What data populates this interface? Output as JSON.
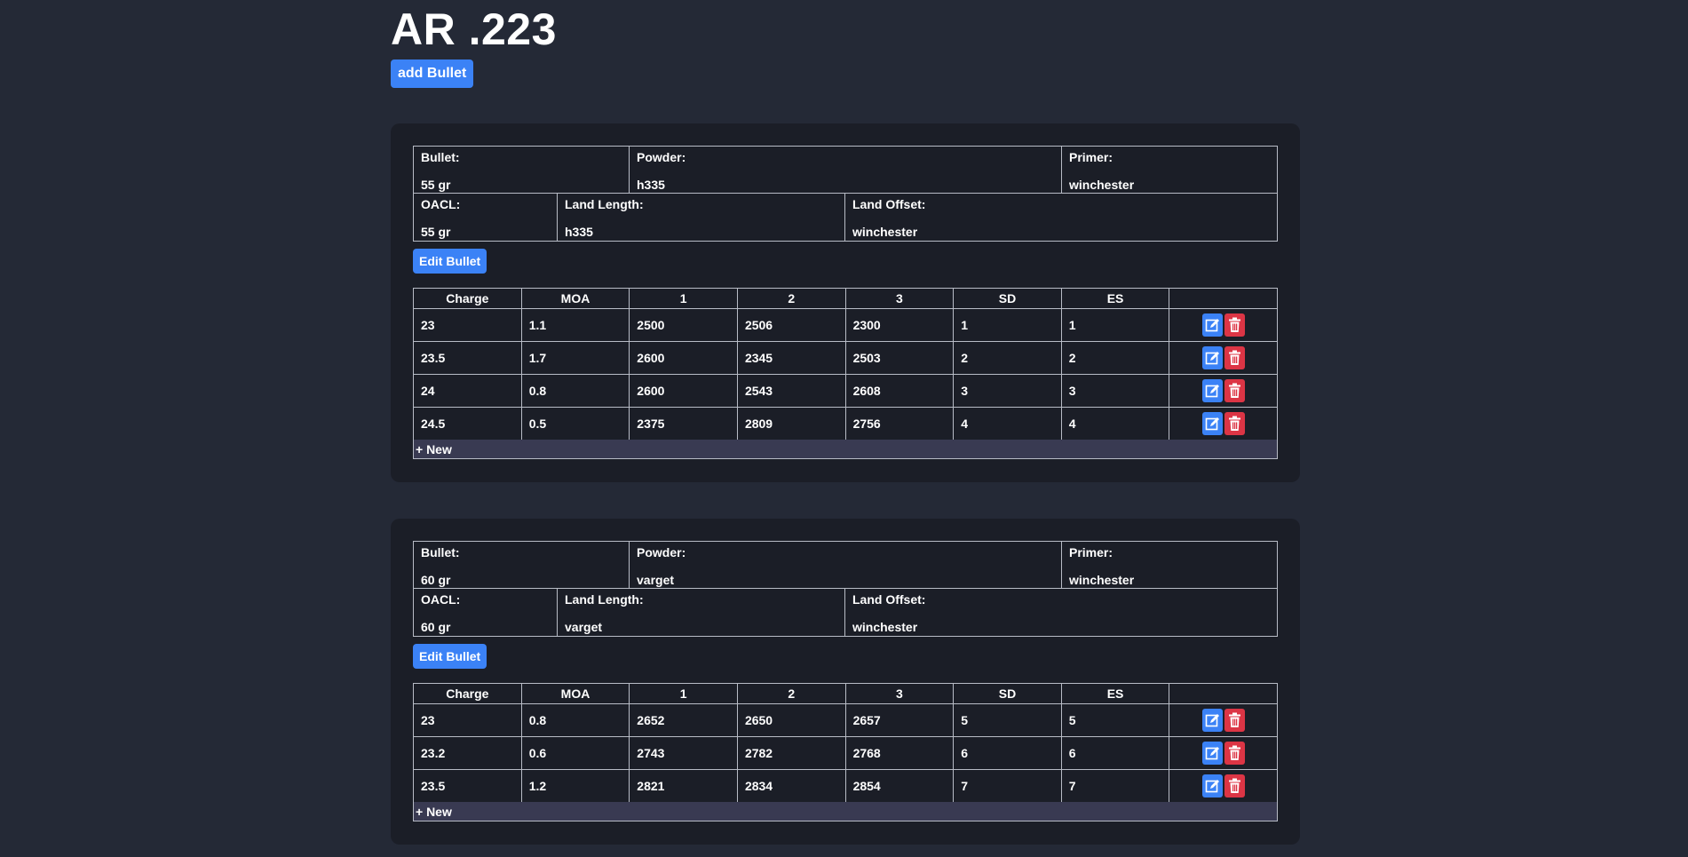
{
  "page": {
    "title": "AR .223",
    "add_bullet_label": "add Bullet"
  },
  "cards": [
    {
      "info": {
        "bullet_label": "Bullet:",
        "bullet_value": "55 gr",
        "powder_label": "Powder:",
        "powder_value": "h335",
        "primer_label": "Primer:",
        "primer_value": "winchester",
        "oacl_label": "OACL:",
        "oacl_value": "55 gr",
        "land_length_label": "Land Length:",
        "land_length_value": "h335",
        "land_offset_label": "Land Offset:",
        "land_offset_value": "winchester"
      },
      "edit_label": "Edit Bullet",
      "columns": [
        "Charge",
        "MOA",
        "1",
        "2",
        "3",
        "SD",
        "ES",
        ""
      ],
      "rows": [
        [
          "23",
          "1.1",
          "2500",
          "2506",
          "2300",
          "1",
          "1"
        ],
        [
          "23.5",
          "1.7",
          "2600",
          "2345",
          "2503",
          "2",
          "2"
        ],
        [
          "24",
          "0.8",
          "2600",
          "2543",
          "2608",
          "3",
          "3"
        ],
        [
          "24.5",
          "0.5",
          "2375",
          "2809",
          "2756",
          "4",
          "4"
        ]
      ],
      "new_label": "+ New"
    },
    {
      "info": {
        "bullet_label": "Bullet:",
        "bullet_value": "60 gr",
        "powder_label": "Powder:",
        "powder_value": "varget",
        "primer_label": "Primer:",
        "primer_value": "winchester",
        "oacl_label": "OACL:",
        "oacl_value": "60 gr",
        "land_length_label": "Land Length:",
        "land_length_value": "varget",
        "land_offset_label": "Land Offset:",
        "land_offset_value": "winchester"
      },
      "edit_label": "Edit Bullet",
      "columns": [
        "Charge",
        "MOA",
        "1",
        "2",
        "3",
        "SD",
        "ES",
        ""
      ],
      "rows": [
        [
          "23",
          "0.8",
          "2652",
          "2650",
          "2657",
          "5",
          "5"
        ],
        [
          "23.2",
          "0.6",
          "2743",
          "2782",
          "2768",
          "6",
          "6"
        ],
        [
          "23.5",
          "1.2",
          "2821",
          "2834",
          "2854",
          "7",
          "7"
        ]
      ],
      "new_label": "+ New"
    }
  ],
  "colors": {
    "background": "#242936",
    "card": "#1b1e27",
    "primary": "#3b82f6",
    "danger": "#dc3545",
    "new_row": "#393a52"
  },
  "icons": {
    "edit": "edit-icon",
    "delete": "trash-icon"
  }
}
